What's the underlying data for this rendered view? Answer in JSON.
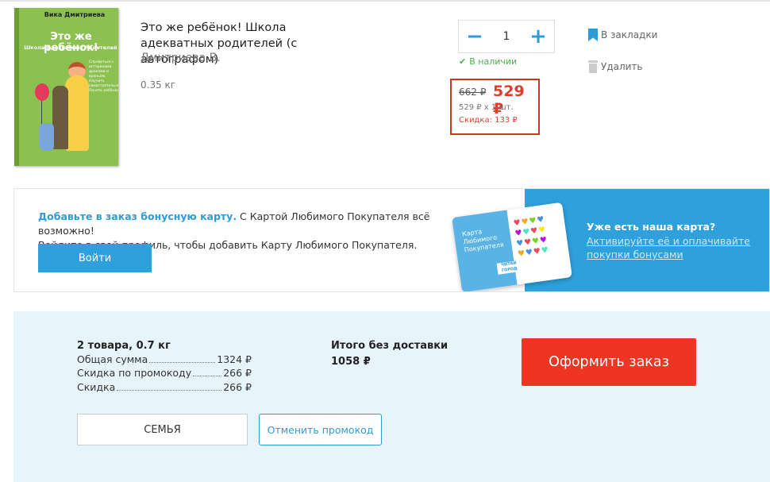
{
  "product": {
    "cover": {
      "author": "Вика Дмитриева",
      "title": "Это же ребёнок!",
      "subtitle": "Школа Адекватных Родителей",
      "blurb": "Справиться с истериками, драками и враньём. Научить самостоятельности. Понять ребёнка."
    },
    "title": "Это же ребёнок! Школа адекватных родителей (с автографом)",
    "author": "Дмитриева В.",
    "weight": "0.35 кг",
    "quantity": "1",
    "minus_label": "−",
    "plus_label": "+",
    "stock_status": "В наличии",
    "stock_icon": "✔",
    "old_price": "662 ₽",
    "price": "529 ₽",
    "unit_line": "529 ₽ x 1 шт.",
    "discount_line": "Скидка: 133 ₽",
    "bookmark_label": "В закладки",
    "delete_label": "Удалить"
  },
  "bonus": {
    "heading": "Добавьте в заказ бонусную карту.",
    "text1": " С Картой Любимого Покупателя всё возможно!",
    "text2": "Войдите в свой профиль, чтобы добавить Карту Любимого Покупателя.",
    "login_label": "Войти",
    "has_card": "Уже есть наша карта?",
    "activate_link": "Активируйте её и оплачивайте покупки бонусами",
    "card_caption": "Карта Любимого Покупателя",
    "card_logo": "ЧИТАЙ ГОРОД"
  },
  "summary": {
    "items": "2 товара, 0.7 кг",
    "rows": [
      {
        "label": "Общая сумма",
        "value": "1324 ₽"
      },
      {
        "label": "Скидка по промокоду",
        "value": "266 ₽"
      },
      {
        "label": "Скидка",
        "value": "266 ₽"
      }
    ],
    "total_label": "Итого без доставки",
    "total_value": "1058 ₽",
    "checkout_label": "Оформить заказ",
    "promo_code": "СЕМЬЯ",
    "cancel_promo_label": "Отменить промокод"
  },
  "colors": {
    "accent": "#2e9bd6",
    "price_red": "#e03e2d",
    "checkout_red": "#ee3524",
    "panel_bg": "#e8f4fb"
  }
}
